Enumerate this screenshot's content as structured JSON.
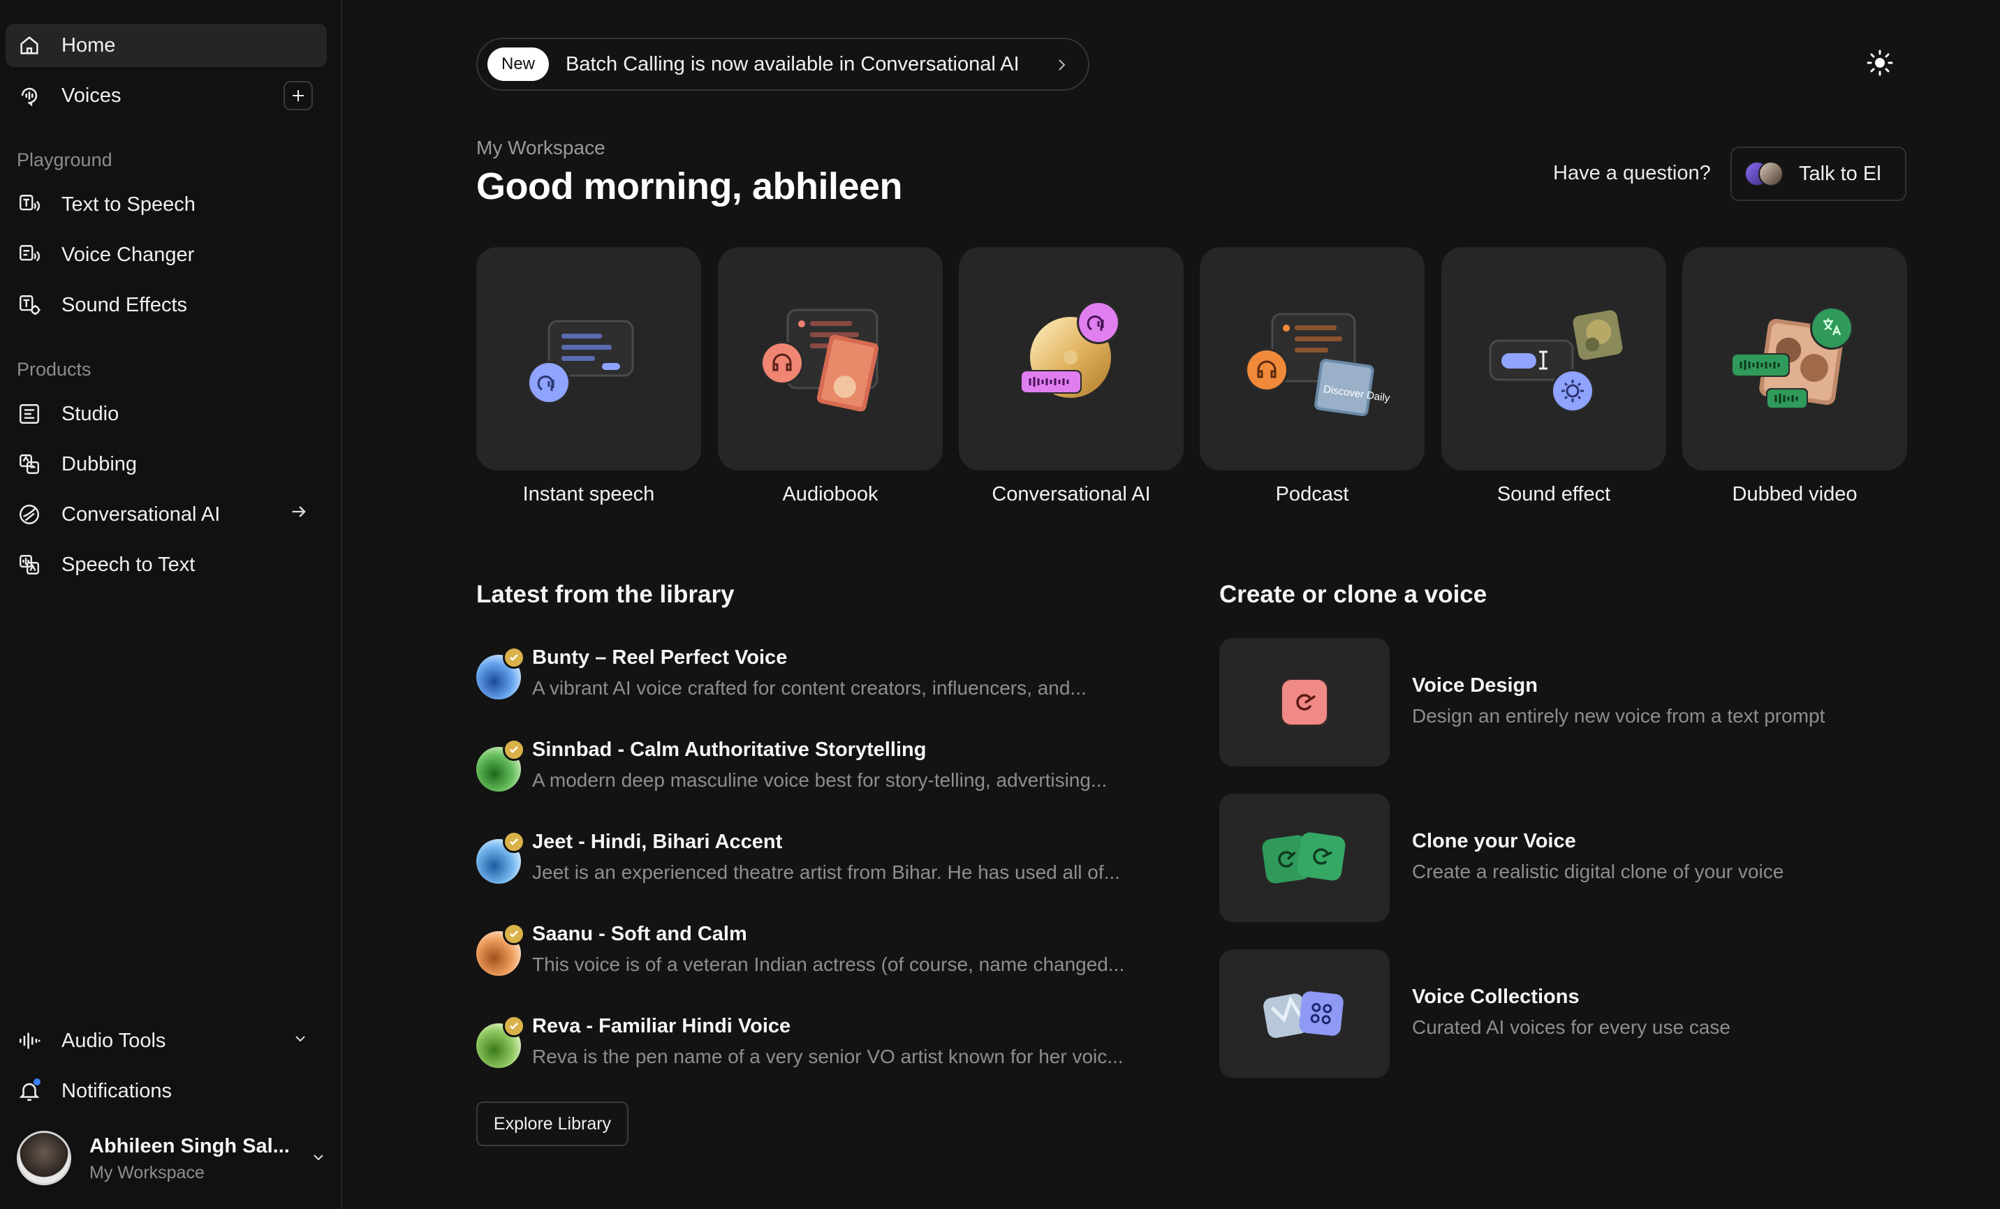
{
  "sidebar": {
    "home": "Home",
    "voices": "Voices",
    "playground_heading": "Playground",
    "playground": [
      "Text to Speech",
      "Voice Changer",
      "Sound Effects"
    ],
    "products_heading": "Products",
    "products": [
      "Studio",
      "Dubbing",
      "Conversational AI",
      "Speech to Text"
    ],
    "audio_tools": "Audio Tools",
    "notifications": "Notifications",
    "user_name": "Abhileen Singh Sal...",
    "user_workspace": "My Workspace"
  },
  "announcement": {
    "badge": "New",
    "text": "Batch Calling is now available in Conversational AI"
  },
  "header": {
    "workspace": "My Workspace",
    "greeting": "Good morning, abhileen",
    "question": "Have a question?",
    "talk_button": "Talk to El"
  },
  "quick_cards": [
    "Instant speech",
    "Audiobook",
    "Conversational AI",
    "Podcast",
    "Sound effect",
    "Dubbed video"
  ],
  "library": {
    "title": "Latest from the library",
    "items": [
      {
        "name": "Bunty – Reel Perfect Voice",
        "desc": "A vibrant AI voice crafted for content creators, influencers, and..."
      },
      {
        "name": "Sinnbad - Calm Authoritative Storytelling",
        "desc": "A modern deep masculine voice best for story-telling, advertising..."
      },
      {
        "name": "Jeet - Hindi, Bihari Accent",
        "desc": "Jeet is an experienced theatre artist from Bihar. He has used all of..."
      },
      {
        "name": "Saanu - Soft and Calm",
        "desc": "This voice is of a veteran Indian actress (of course, name changed..."
      },
      {
        "name": "Reva - Familiar Hindi Voice",
        "desc": "Reva is the pen name of a very senior VO artist known for her voic..."
      }
    ],
    "explore_button": "Explore Library"
  },
  "create": {
    "title": "Create or clone a voice",
    "items": [
      {
        "title": "Voice Design",
        "sub": "Design an entirely new voice from a text prompt"
      },
      {
        "title": "Clone your Voice",
        "sub": "Create a realistic digital clone of your voice"
      },
      {
        "title": "Voice Collections",
        "sub": "Curated AI voices for every use case"
      }
    ]
  },
  "podcast_art_text": "Discover Daily",
  "icons": {
    "home": "home-icon",
    "voices": "voices-icon",
    "tts": "text-to-speech-icon",
    "voice_changer": "voice-changer-icon",
    "sfx": "sound-effects-icon",
    "studio": "studio-icon",
    "dubbing": "dubbing-icon",
    "conv_ai": "conversational-ai-icon",
    "stt": "speech-to-text-icon",
    "audio_tools": "waveform-icon",
    "bell": "bell-icon",
    "theme": "sun-icon"
  },
  "colors": {
    "background": "#131313",
    "sidebar_active": "#252525",
    "card": "#262626",
    "muted_text": "#8e8e8e",
    "verified_badge": "#d9b24a",
    "notification_dot": "#3b82f6"
  }
}
